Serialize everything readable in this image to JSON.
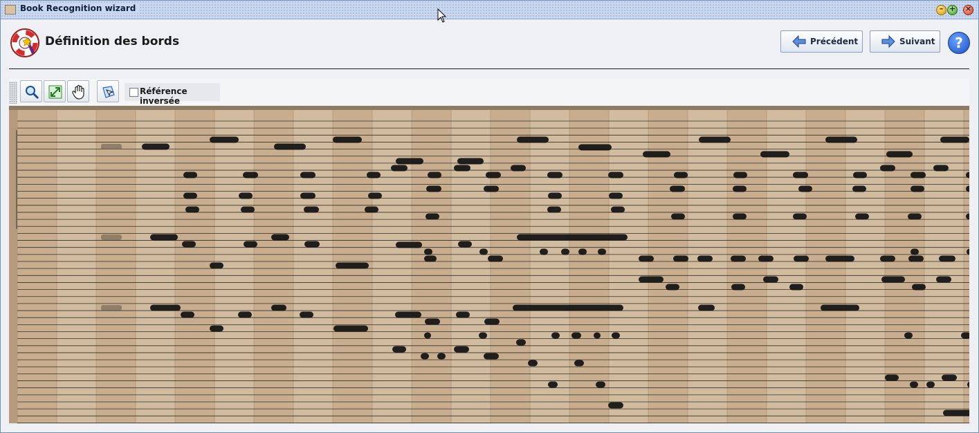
{
  "window": {
    "title": "Book Recognition wizard"
  },
  "header": {
    "title": "Définition des bords"
  },
  "nav": {
    "previous_label": "Précédent",
    "next_label": "Suivant",
    "help_label": "?"
  },
  "toolbar": {
    "reverse_reference_label": "Référence inversée",
    "reverse_reference_checked": false
  },
  "colors": {
    "accent": "#2a64d8",
    "paper": "#cdb597",
    "ink": "#111111"
  },
  "icons": [
    "zoom-icon",
    "fit-icon",
    "pan-hand-icon",
    "select-icon"
  ]
}
